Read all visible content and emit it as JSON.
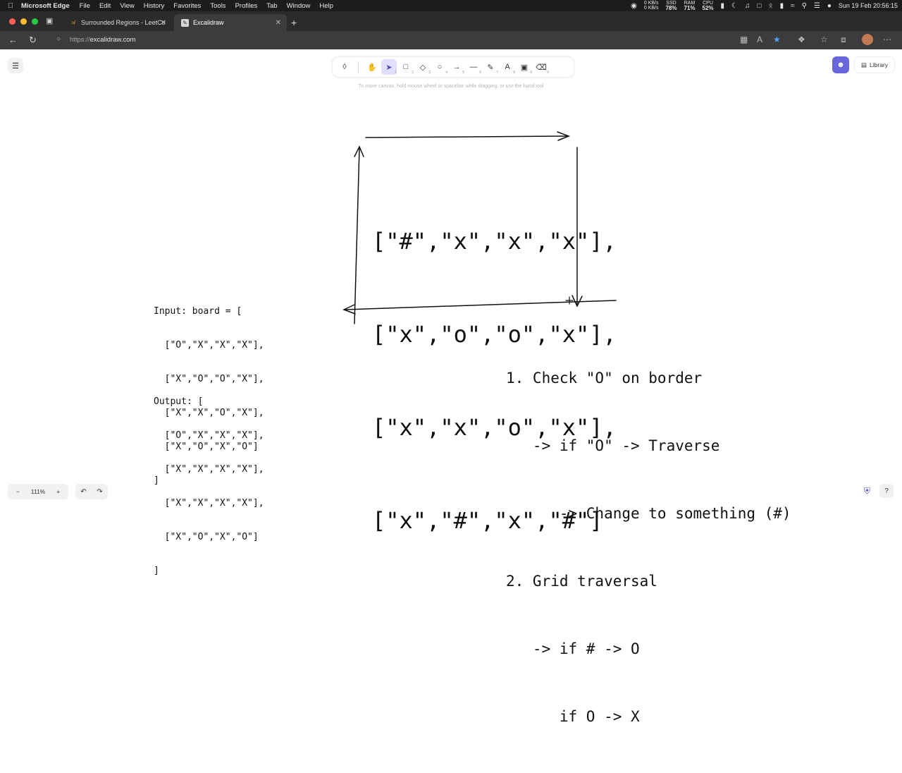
{
  "menubar": {
    "app_name": "Microsoft Edge",
    "items": [
      "File",
      "Edit",
      "View",
      "History",
      "Favorites",
      "Tools",
      "Profiles",
      "Tab",
      "Window",
      "Help"
    ],
    "net_up": "0 KB/s",
    "net_down": "0 KB/s",
    "ssd_label": "SSD",
    "ssd_value": "78%",
    "ram_label": "RAM",
    "ram_value": "71%",
    "cpu_label": "CPU",
    "cpu_value": "52%",
    "datetime": "Sun 19 Feb  20:56:15"
  },
  "tabs": [
    {
      "title": "Surrounded Regions - LeetCo",
      "icon": "leetcode-icon"
    },
    {
      "title": "Excalidraw",
      "icon": "excalidraw-icon"
    }
  ],
  "address": {
    "protocol": "https://",
    "host": "excalidraw.com"
  },
  "excalidraw": {
    "hint": "To move canvas, hold mouse wheel or spacebar while dragging, or use the hand tool",
    "library_label": "Library",
    "zoom": "111%",
    "tools": [
      {
        "icon": "lock-icon",
        "num": ""
      },
      {
        "icon": "hand-icon",
        "num": ""
      },
      {
        "icon": "pointer-icon",
        "num": "1"
      },
      {
        "icon": "rectangle-icon",
        "num": "2"
      },
      {
        "icon": "diamond-icon",
        "num": "3"
      },
      {
        "icon": "ellipse-icon",
        "num": "4"
      },
      {
        "icon": "arrow-icon",
        "num": "5"
      },
      {
        "icon": "line-icon",
        "num": "6"
      },
      {
        "icon": "pencil-icon",
        "num": "7"
      },
      {
        "icon": "text-icon",
        "num": "8"
      },
      {
        "icon": "image-icon",
        "num": "9"
      },
      {
        "icon": "eraser-icon",
        "num": "0"
      }
    ]
  },
  "drawing": {
    "grid_rows": [
      "[\"#\",\"x\",\"x\",\"x\"],",
      "[\"x\",\"o\",\"o\",\"x\"],",
      "[\"x\",\"x\",\"o\",\"x\"],",
      "[\"x\",\"#\",\"x\",\"#\"]"
    ],
    "input_lines": [
      "Input: board = [",
      "  [\"O\",\"X\",\"X\",\"X\"],",
      "  [\"X\",\"O\",\"O\",\"X\"],",
      "  [\"X\",\"X\",\"O\",\"X\"],",
      "  [\"X\",\"O\",\"X\",\"O\"]",
      "]"
    ],
    "output_lines": [
      "Output: [",
      "  [\"O\",\"X\",\"X\",\"X\"],",
      "  [\"X\",\"X\",\"X\",\"X\"],",
      "  [\"X\",\"X\",\"X\",\"X\"],",
      "  [\"X\",\"O\",\"X\",\"O\"]",
      "]"
    ],
    "steps": [
      "1. Check \"O\" on border",
      "   -> if \"O\" -> Traverse",
      "      -> Change to something (#)",
      "2. Grid traversal",
      "   -> if # -> O",
      "      if O -> X"
    ]
  }
}
